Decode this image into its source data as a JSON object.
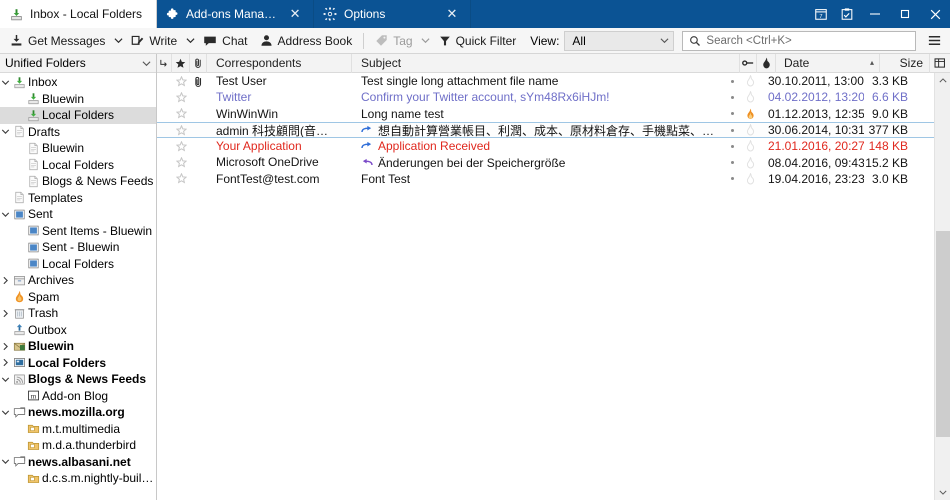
{
  "window": {
    "titlebar_color": "#0b5394",
    "controls": [
      {
        "name": "calendar-button",
        "glyph": "calendar-icon"
      },
      {
        "name": "tasks-button",
        "glyph": "tasks-icon"
      },
      {
        "name": "minimize-button",
        "glyph": "minimize-icon"
      },
      {
        "name": "maximize-button",
        "glyph": "maximize-icon"
      },
      {
        "name": "close-button",
        "glyph": "close-icon"
      }
    ]
  },
  "tabs": [
    {
      "label": "Inbox - Local Folders",
      "icon": "inbox-download-icon",
      "active": true,
      "closable": false
    },
    {
      "label": "Add-ons Manager",
      "icon": "addons-puzzle-icon",
      "active": false,
      "closable": true,
      "close_label": "✕"
    },
    {
      "label": "Options",
      "icon": "gear-icon",
      "active": false,
      "closable": true,
      "close_label": "✕"
    }
  ],
  "toolbar": {
    "get_messages_label": "Get Messages",
    "write_label": "Write",
    "chat_label": "Chat",
    "address_book_label": "Address Book",
    "tag_label": "Tag",
    "tag_disabled": true,
    "quick_filter_label": "Quick Filter",
    "view_label": "View:",
    "view_value": "All",
    "view_options": [
      "All"
    ],
    "search_placeholder": "Search <Ctrl+K>",
    "search_value": "",
    "dropdown_glyph": "⌄",
    "app_menu_glyph": "☰"
  },
  "folder_pane": {
    "header_label": "Unified Folders",
    "header_dropdown_glyph": "⌄",
    "items": [
      {
        "label": "Inbox",
        "indent": 0,
        "twisty": "open",
        "icon": "inbox-icon",
        "bold": false,
        "selected": false
      },
      {
        "label": "Bluewin",
        "indent": 1,
        "twisty": "none",
        "icon": "inbox-icon",
        "bold": false,
        "selected": false
      },
      {
        "label": "Local Folders",
        "indent": 1,
        "twisty": "none",
        "icon": "inbox-icon",
        "bold": false,
        "selected": true
      },
      {
        "label": "Drafts",
        "indent": 0,
        "twisty": "open",
        "icon": "drafts-icon",
        "bold": false,
        "selected": false
      },
      {
        "label": "Bluewin",
        "indent": 1,
        "twisty": "none",
        "icon": "drafts-icon",
        "bold": false,
        "selected": false
      },
      {
        "label": "Local Folders",
        "indent": 1,
        "twisty": "none",
        "icon": "drafts-icon",
        "bold": false,
        "selected": false
      },
      {
        "label": "Blogs & News Feeds",
        "indent": 1,
        "twisty": "none",
        "icon": "drafts-icon",
        "bold": false,
        "selected": false
      },
      {
        "label": "Templates",
        "indent": 0,
        "twisty": "none",
        "icon": "templates-icon",
        "bold": false,
        "selected": false
      },
      {
        "label": "Sent",
        "indent": 0,
        "twisty": "open",
        "icon": "sent-icon",
        "bold": false,
        "selected": false
      },
      {
        "label": "Sent Items - Bluewin",
        "indent": 1,
        "twisty": "none",
        "icon": "sent-icon",
        "bold": false,
        "selected": false
      },
      {
        "label": "Sent - Bluewin",
        "indent": 1,
        "twisty": "none",
        "icon": "sent-icon",
        "bold": false,
        "selected": false
      },
      {
        "label": "Local Folders",
        "indent": 1,
        "twisty": "none",
        "icon": "sent-icon",
        "bold": false,
        "selected": false
      },
      {
        "label": "Archives",
        "indent": 0,
        "twisty": "closed",
        "icon": "archive-icon",
        "bold": false,
        "selected": false
      },
      {
        "label": "Spam",
        "indent": 0,
        "twisty": "none",
        "icon": "junk-flame-icon",
        "bold": false,
        "selected": false
      },
      {
        "label": "Trash",
        "indent": 0,
        "twisty": "closed",
        "icon": "trash-icon",
        "bold": false,
        "selected": false
      },
      {
        "label": "Outbox",
        "indent": 0,
        "twisty": "none",
        "icon": "outbox-icon",
        "bold": false,
        "selected": false
      },
      {
        "label": "Bluewin",
        "indent": 0,
        "twisty": "closed",
        "icon": "account-mail-icon",
        "bold": true,
        "selected": false
      },
      {
        "label": "Local Folders",
        "indent": 0,
        "twisty": "closed",
        "icon": "local-folders-icon",
        "bold": true,
        "selected": false
      },
      {
        "label": "Blogs & News Feeds",
        "indent": 0,
        "twisty": "open",
        "icon": "feeds-icon",
        "bold": true,
        "selected": false
      },
      {
        "label": "Add-on Blog",
        "indent": 1,
        "twisty": "none",
        "icon": "mozilla-m-icon",
        "bold": false,
        "selected": false
      },
      {
        "label": "news.mozilla.org",
        "indent": 0,
        "twisty": "open",
        "icon": "newsgroup-icon",
        "bold": true,
        "selected": false
      },
      {
        "label": "m.t.multimedia",
        "indent": 1,
        "twisty": "none",
        "icon": "newsgroup-folder-icon",
        "bold": false,
        "selected": false
      },
      {
        "label": "m.d.a.thunderbird",
        "indent": 1,
        "twisty": "none",
        "icon": "newsgroup-folder-icon",
        "bold": false,
        "selected": false
      },
      {
        "label": "news.albasani.net",
        "indent": 0,
        "twisty": "open",
        "icon": "newsgroup-icon",
        "bold": true,
        "selected": false
      },
      {
        "label": "d.c.s.m.nightly-builds",
        "indent": 1,
        "twisty": "none",
        "icon": "newsgroup-folder-icon",
        "bold": false,
        "selected": false
      }
    ]
  },
  "thread_pane": {
    "columns": {
      "thread_icon": "thread-column-icon",
      "star_icon": "star-column-icon",
      "attachment_icon": "paperclip-column-icon",
      "correspondents": "Correspondents",
      "subject": "Subject",
      "unread_icon": "unread-column-icon",
      "junk_icon": "junk-column-icon",
      "date": "Date",
      "date_sort": "ascending",
      "date_sort_glyph": "▴",
      "size": "Size",
      "picker_icon": "column-picker-icon"
    },
    "messages": [
      {
        "correspondent": "Test User",
        "subject": "Test single long attachment file name",
        "date": "30.10.2011, 13:00",
        "size": "3.3 KB",
        "color": "#141414",
        "starred": false,
        "attachment": true,
        "junk": false,
        "state_icon": "none",
        "selected": false
      },
      {
        "correspondent": "Twitter",
        "subject": "Confirm your Twitter account, sYm48Rx6iHJm!",
        "date": "04.02.2012, 13:20",
        "size": "6.6 KB",
        "color": "#6f6fc8",
        "starred": false,
        "attachment": false,
        "junk": false,
        "state_icon": "none",
        "selected": false
      },
      {
        "correspondent": "WinWinWin",
        "subject": "Long name test",
        "date": "01.12.2013, 12:35",
        "size": "9.0 KB",
        "color": "#141414",
        "starred": false,
        "attachment": false,
        "junk": true,
        "state_icon": "none",
        "selected": false
      },
      {
        "correspondent": "admin 科技顧問(音…",
        "subject": "想自動計算營業帳目、利潤、成本、原材料倉存、手機點菜、水吧廚房自動出單 (詳細資料…)",
        "date": "30.06.2014, 10:31",
        "size": "377 KB",
        "color": "#141414",
        "starred": false,
        "attachment": false,
        "junk": false,
        "state_icon": "forwarded",
        "selected": true
      },
      {
        "correspondent": "Your Application",
        "subject": "Application Received",
        "date": "21.01.2016, 20:27",
        "size": "148 KB",
        "color": "#e0281e",
        "starred": false,
        "attachment": false,
        "junk": false,
        "state_icon": "forwarded-red",
        "selected": false
      },
      {
        "correspondent": "Microsoft OneDrive",
        "subject": "Änderungen bei der Speichergröße",
        "date": "08.04.2016, 09:43",
        "size": "15.2 KB",
        "color": "#141414",
        "starred": false,
        "attachment": false,
        "junk": false,
        "state_icon": "replied",
        "selected": false
      },
      {
        "correspondent": "FontTest@test.com",
        "subject": "Font Test",
        "date": "19.04.2016, 23:23",
        "size": "3.0 KB",
        "color": "#141414",
        "starred": false,
        "attachment": false,
        "junk": false,
        "state_icon": "none",
        "selected": false
      }
    ],
    "scrollbar": {
      "up_glyph": "▲",
      "down_glyph": "▼",
      "thumb_top_pct": 36,
      "thumb_height_pct": 52
    }
  }
}
